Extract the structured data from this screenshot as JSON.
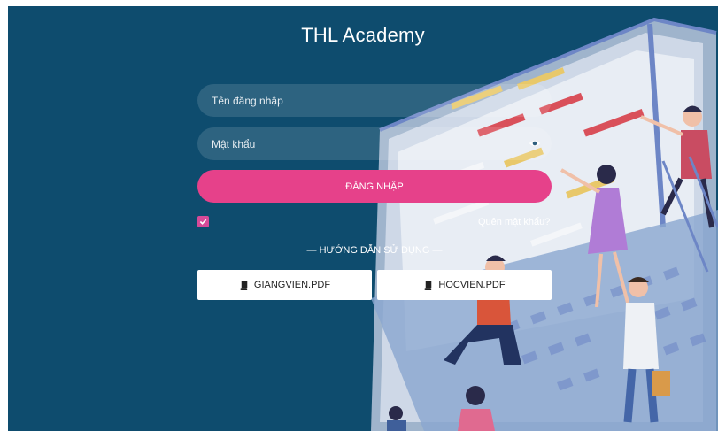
{
  "app": {
    "title": "THL Academy"
  },
  "form": {
    "username_placeholder": "Tên đăng nhập",
    "password_placeholder": "Mật khẩu",
    "login_label": "ĐĂNG NHẬP",
    "remember_checked": true,
    "forgot_label": "Quên mật khẩu?"
  },
  "guide": {
    "heading": "— HƯỚNG DẪN SỬ DỤNG —",
    "files": [
      {
        "label": "GIANGVIEN.PDF",
        "icon": "book-icon"
      },
      {
        "label": "HOCVIEN.PDF",
        "icon": "book-icon"
      }
    ]
  },
  "colors": {
    "background": "#0e4c6e",
    "accent": "#e6418a",
    "checkbox": "#d64a98"
  }
}
